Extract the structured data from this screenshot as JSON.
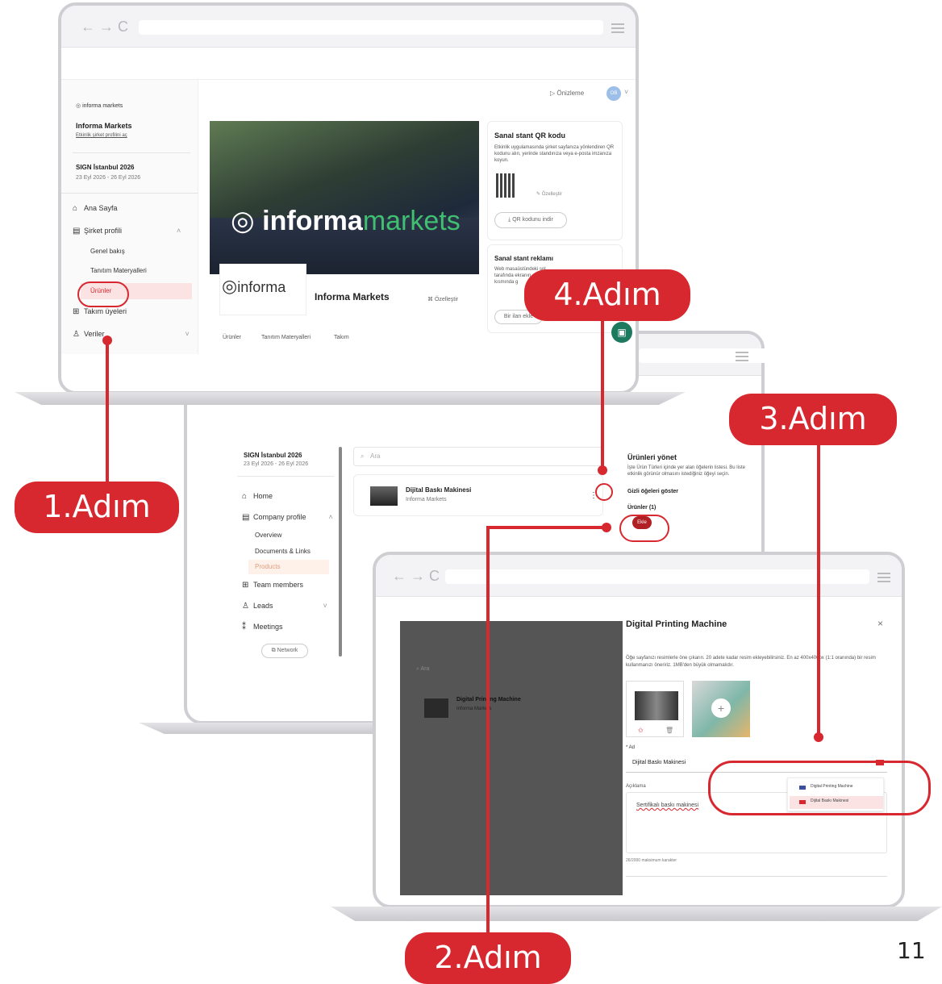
{
  "top_window": {
    "brand_logo_text": "informa markets",
    "company_name": "Informa Markets",
    "company_link": "Etkinlik şirket profilini aç",
    "event_name": "SIGN İstanbul 2026",
    "event_dates": "23 Eyl 2026 - 26 Eyl 2026",
    "nav": [
      "Ana Sayfa",
      "Şirket profili",
      "Genel bakış",
      "Tanıtım Materyalleri",
      "Ürünler",
      "Takım üyeleri",
      "Veriler"
    ],
    "preview_button": "Önizleme",
    "avatar_initials": "OB",
    "banner_logo": "informa markets",
    "banner_logo_word_a": "informa",
    "banner_logo_word_b": "markets",
    "company_logo": "informa",
    "company_title": "Informa Markets",
    "customize_label": "Özelleştir",
    "tabs": [
      "Ürünler",
      "Tanıtım Materyalleri",
      "Takım"
    ],
    "qr_title": "Sanal stant QR kodu",
    "qr_desc": "Etkinlik uygulamasında şirket sayfanıza yönlendiren QR kodunu alın, yerinde standınıza veya e-posta imzanıza koyun.",
    "qr_customize": "Özelleştir",
    "qr_download": "QR kodunu indir",
    "ad_title": "Sanal stant reklamı",
    "ad_desc": "Web masaüstündeki sol tarafında ekranın görünür kısmında g",
    "ad_button": "Bir ilan ekle"
  },
  "middle_window": {
    "event_name": "SIGN İstanbul 2026",
    "event_dates": "23 Eyl 2026 - 26 Eyl 2026",
    "nav": [
      "Home",
      "Company profile",
      "Overview",
      "Documents & Links",
      "Products",
      "Team members",
      "Leads",
      "Meetings"
    ],
    "network_button": "Network",
    "search_placeholder": "Ara",
    "product_name": "Dijital Baskı Makinesi",
    "product_company": "Informa Markets",
    "panel_title": "Ürünleri yönet",
    "panel_desc": "İşte Ürün Türleri içinde yer alan öğelerin listesi. Bu liste etkinlik görünür olmasını istediğiniz öğeyi seçin.",
    "panel_show": "Gizli öğeleri göster",
    "panel_count": "Ürünler (1)",
    "add_button": "Ekle"
  },
  "front_window": {
    "modal_title": "Digital Printing Machine",
    "modal_desc": "Öğe sayfanızı resimlerle öne çıkarın. 20 adete kadar resim ekleyebilirsiniz. En az 400x400px (1:1 oranında) bir resim kullanmanızı öneririz. 1MB'den büyük olmamalıdır.",
    "name_label": "* Ad",
    "name_value": "Dijital Baskı Makinesi",
    "desc_label": "Açıklama",
    "desc_value": "Sertifikalı baskı makinesi",
    "char_count": "26/2000 maksimum karakter",
    "search_placeholder": "Ara",
    "bg_product_name": "Digital Printing Machine",
    "bg_product_company": "Informa Markets",
    "lang_options": [
      "Digital Printing Machine",
      "Dijital Baskı Makinesi"
    ]
  },
  "callouts": {
    "step1": "1.Adım",
    "step2": "2.Adım",
    "step3": "3.Adım",
    "step4": "4.Adım"
  },
  "page_number": "11",
  "colors": {
    "accent": "#d7282f",
    "highlight_bg": "#fbe3e4",
    "green": "#3fbf6f"
  }
}
